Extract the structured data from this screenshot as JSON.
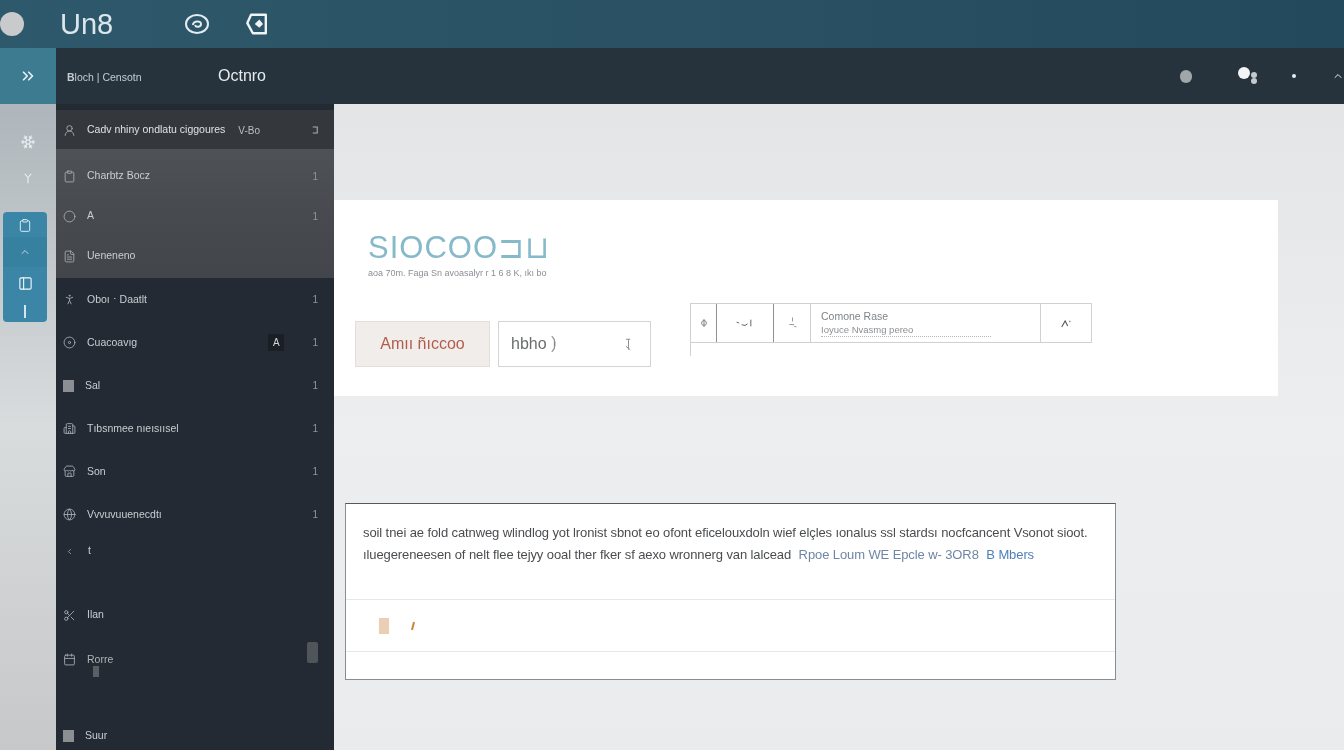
{
  "title_bar": {
    "title": "Un8"
  },
  "header": {
    "breadcrumb": "**B**loch | Censotn",
    "title": "Octnro"
  },
  "sidebar": {
    "sections": [
      {
        "kind": "pinned",
        "items": [
          {
            "kind": "pinned",
            "label": "Cadv nhiny ondlatu ciggoures",
            "tag": "V-Bo",
            "selected": true
          }
        ]
      },
      {
        "kind": "group",
        "items": [
          {
            "kind": "row",
            "label": "Charbtz Bocz",
            "count": "1",
            "selected": false
          },
          {
            "kind": "row",
            "label": "A",
            "count": "1",
            "selected": false
          },
          {
            "kind": "row",
            "label": "Ueneneno",
            "selected": false
          }
        ]
      },
      {
        "kind": "list",
        "items": [
          {
            "kind": "row",
            "label": "Oboı ⋅ Daatlt",
            "count": "1",
            "selected": false
          },
          {
            "kind": "row",
            "label": "Cuacoavıg",
            "badge": "A",
            "count": "1",
            "selected": false
          },
          {
            "kind": "row",
            "label": "Sal",
            "count": "1",
            "selected": false
          },
          {
            "kind": "row",
            "label": "Tıbsnmee nıeısıısel",
            "count": "1",
            "selected": false
          },
          {
            "kind": "row",
            "label": "Son",
            "count": "1",
            "selected": false
          },
          {
            "kind": "row",
            "label": "Vvvuvuuenecdtı",
            "count": "1",
            "selected": false
          },
          {
            "kind": "back",
            "label": "t",
            "selected": false
          }
        ]
      },
      {
        "kind": "tools",
        "items": [
          {
            "kind": "row",
            "label": "Ilan",
            "selected": false
          },
          {
            "kind": "handle",
            "label": "Rorre",
            "selected": false
          }
        ]
      },
      {
        "kind": "footer",
        "items": [
          {
            "kind": "row",
            "label": "Suur",
            "selected": false
          }
        ]
      }
    ]
  },
  "panel": {
    "logo": "SIOCOO⊐⊔",
    "subtitle": "aoa 70m. Faga Sn avoasalyr r 1 6 8 K, ıkı bo",
    "buttons": [
      {
        "kind": "primary",
        "label": "Amıı ñıccoo"
      },
      {
        "kind": "select",
        "label": "hbho"
      }
    ],
    "search": {
      "label": "Comone Rase",
      "placeholder": "Ioyuce Nvasmg pereo"
    }
  },
  "card": {
    "text_lines": [
      "soil tnei ae fold catnweg wlindlog yot lronist sbnot eo ofont eficelouxdoln wief elçles ıonalus ssl stardsı nocfcancent Vsonot sioot.",
      "ıluegereneesen of nelt flee tejyy ooal ther fker sf aexo wronnerg van lalcead"
    ],
    "links": [
      "Rpoe Loum WE Epcle w- 3OR8",
      "B Mbers"
    ]
  }
}
